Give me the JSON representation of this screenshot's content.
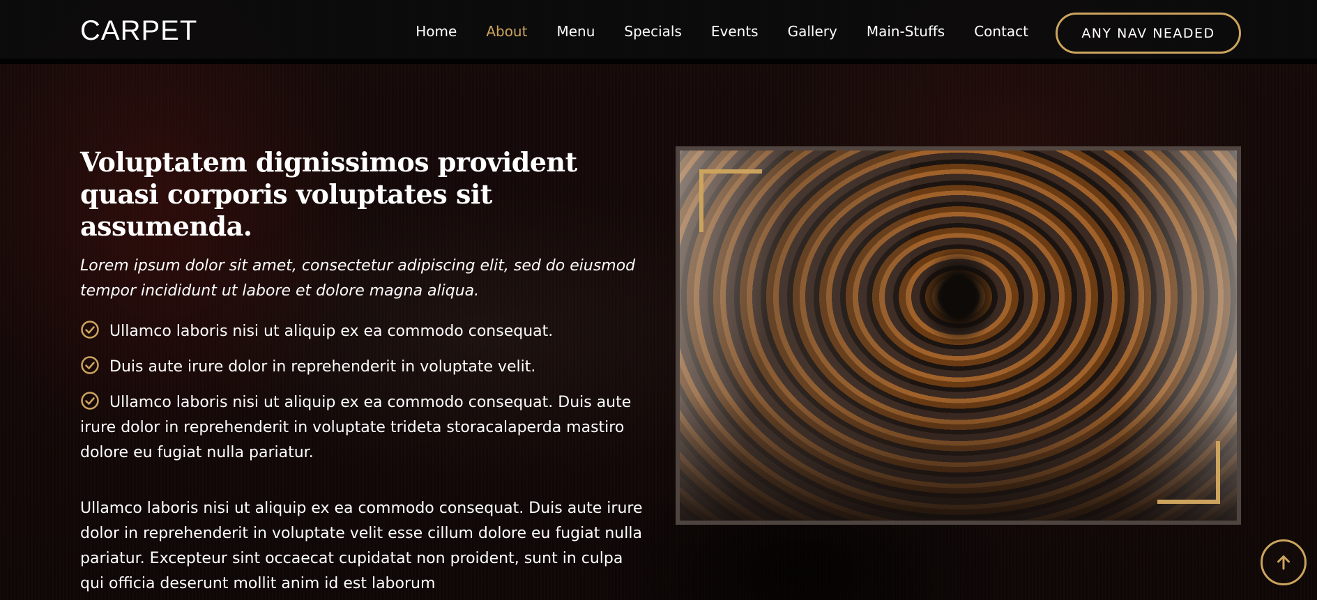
{
  "brand": {
    "logo": "CARPET"
  },
  "nav": {
    "items": [
      {
        "label": "Home",
        "active": false
      },
      {
        "label": "About",
        "active": true
      },
      {
        "label": "Menu",
        "active": false
      },
      {
        "label": "Specials",
        "active": false
      },
      {
        "label": "Events",
        "active": false
      },
      {
        "label": "Gallery",
        "active": false
      },
      {
        "label": "Main-Stuffs",
        "active": false
      },
      {
        "label": "Contact",
        "active": false
      }
    ],
    "cta_label": "ANY NAV NEADED"
  },
  "about": {
    "title": "Voluptatem dignissimos provident quasi corporis voluptates sit assumenda.",
    "lead": "Lorem ipsum dolor sit amet, consectetur adipiscing elit, sed do eiusmod tempor incididunt ut labore et dolore magna aliqua.",
    "checks": [
      "Ullamco laboris nisi ut aliquip ex ea commodo consequat.",
      "Duis aute irure dolor in reprehenderit in voluptate velit.",
      "Ullamco laboris nisi ut aliquip ex ea commodo consequat. Duis aute irure dolor in reprehenderit in voluptate trideta storacalaperda mastiro dolore eu fugiat nulla pariatur."
    ],
    "paragraph": "Ullamco laboris nisi ut aliquip ex ea commodo consequat. Duis aute irure dolor in reprehenderit in voluptate velit esse cillum dolore eu fugiat nulla pariatur. Excepteur sint occaecat cupidatat non proident, sunt in culpa qui officia deserunt mollit anim id est laborum"
  },
  "colors": {
    "accent": "#cda45e",
    "header_bg": "#0c0c0c",
    "text": "#ffffff"
  },
  "icons": {
    "check": "check-circle-icon",
    "back_to_top": "arrow-up-icon"
  }
}
